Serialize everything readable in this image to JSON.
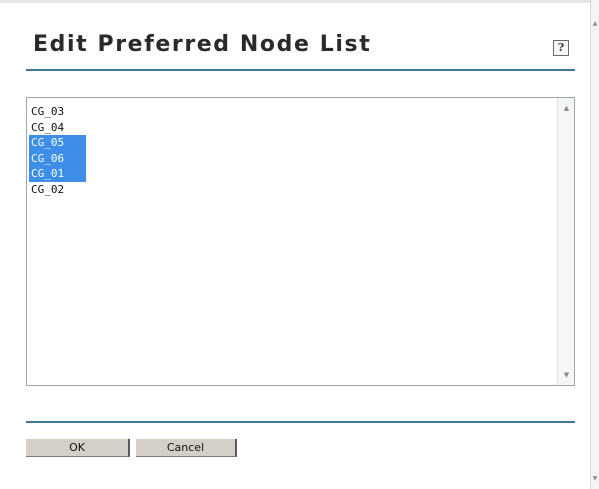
{
  "dialog": {
    "title": "Edit Preferred Node List",
    "help_label": "?"
  },
  "list": {
    "items": [
      {
        "label": "CG_03",
        "selected": false
      },
      {
        "label": "CG_04",
        "selected": false
      },
      {
        "label": "CG_05",
        "selected": true
      },
      {
        "label": "CG_06",
        "selected": true
      },
      {
        "label": "CG_01",
        "selected": true
      },
      {
        "label": "CG_02",
        "selected": false
      }
    ],
    "scroll_up_icon": "triangle-up",
    "scroll_down_icon": "triangle-down"
  },
  "buttons": {
    "ok_label": "OK",
    "cancel_label": "Cancel"
  },
  "colors": {
    "accent_rule": "#3f7a9c",
    "selection": "#3d8ee8",
    "button_face": "#d4d0c8"
  }
}
